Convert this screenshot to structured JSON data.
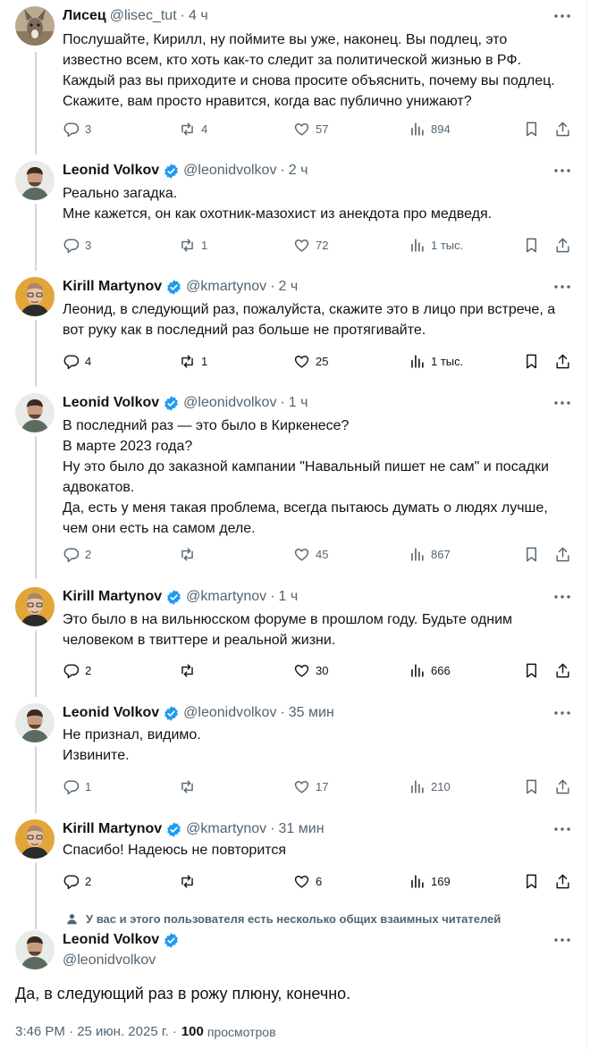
{
  "colors": {
    "verified": "#1d9bf0",
    "text": "#0f1419",
    "muted": "#536471",
    "line": "#cfd9de"
  },
  "icons": {
    "reply": "reply-icon",
    "retweet": "retweet-icon",
    "like": "like-icon",
    "views": "views-icon",
    "bookmark": "bookmark-icon",
    "share": "share-icon",
    "more": "more-icon",
    "verified": "verified-badge-icon"
  },
  "tweets": [
    {
      "name": "Лисец",
      "handle": "@lisec_tut",
      "time": "4 ч",
      "lines": [
        "Послушайте, Кирилл, ну поймите вы уже, наконец. Вы подлец, это",
        "известно всем, кто хоть как-то следит за политической жизнью в РФ.",
        "Каждый раз вы приходите и снова просите объяснить, почему вы подлец.",
        "Скажите, вам просто нравится, когда вас публично унижают?"
      ],
      "replies": "3",
      "retweets": "4",
      "likes": "57",
      "views": "894"
    },
    {
      "name": "Leonid Volkov",
      "handle": "@leonidvolkov",
      "time": "2 ч",
      "lines": [
        "Реально загадка.",
        "Мне кажется, он как охотник-мазохист из анекдота про медведя."
      ],
      "replies": "3",
      "retweets": "1",
      "likes": "72",
      "views": "1 тыс."
    },
    {
      "name": "Kirill Martynov",
      "handle": "@kmartynov",
      "time": "2 ч",
      "lines": [
        "Леонид, в следующий раз, пожалуйста, скажите это в лицо при встрече, а",
        "вот руку как в последний раз больше не протягивайте."
      ],
      "replies": "4",
      "retweets": "1",
      "likes": "25",
      "views": "1 тыс."
    },
    {
      "name": "Leonid Volkov",
      "handle": "@leonidvolkov",
      "time": "1 ч",
      "lines": [
        "В последний раз — это было в Киркенесе?",
        "В марте 2023 года?",
        "Ну это было до заказной кампании \"Навальный пишет не сам\" и посадки",
        "адвокатов.",
        "Да, есть у меня такая проблема, всегда пытаюсь думать о людях лучше,",
        "чем они есть на самом деле."
      ],
      "replies": "2",
      "retweets": "",
      "likes": "45",
      "views": "867"
    },
    {
      "name": "Kirill Martynov",
      "handle": "@kmartynov",
      "time": "1 ч",
      "lines": [
        "Это было в на вильнюсском форуме в прошлом году. Будьте одним",
        "человеком в твиттере и реальной жизни."
      ],
      "replies": "2",
      "retweets": "",
      "likes": "30",
      "views": "666"
    },
    {
      "name": "Leonid Volkov",
      "handle": "@leonidvolkov",
      "time": "35 мин",
      "lines": [
        "Не признал, видимо.",
        "Извините."
      ],
      "replies": "1",
      "retweets": "",
      "likes": "17",
      "views": "210"
    },
    {
      "name": "Kirill Martynov",
      "handle": "@kmartynov",
      "time": "31 мин",
      "lines": [
        "Спасибо! Надеюсь не повторится"
      ],
      "replies": "2",
      "retweets": "",
      "likes": "6",
      "views": "169"
    }
  ],
  "follow_note": "У вас и этого пользователя есть несколько общих взаимных читателей",
  "main": {
    "name": "Leonid Volkov",
    "handle": "@leonidvolkov",
    "text": "Да, в следующий раз в рожу плюну, конечно.",
    "time": "3:46 PM · 25 июн. 2025 г. ·",
    "views_count": "100",
    "views_label": "просмотров"
  }
}
